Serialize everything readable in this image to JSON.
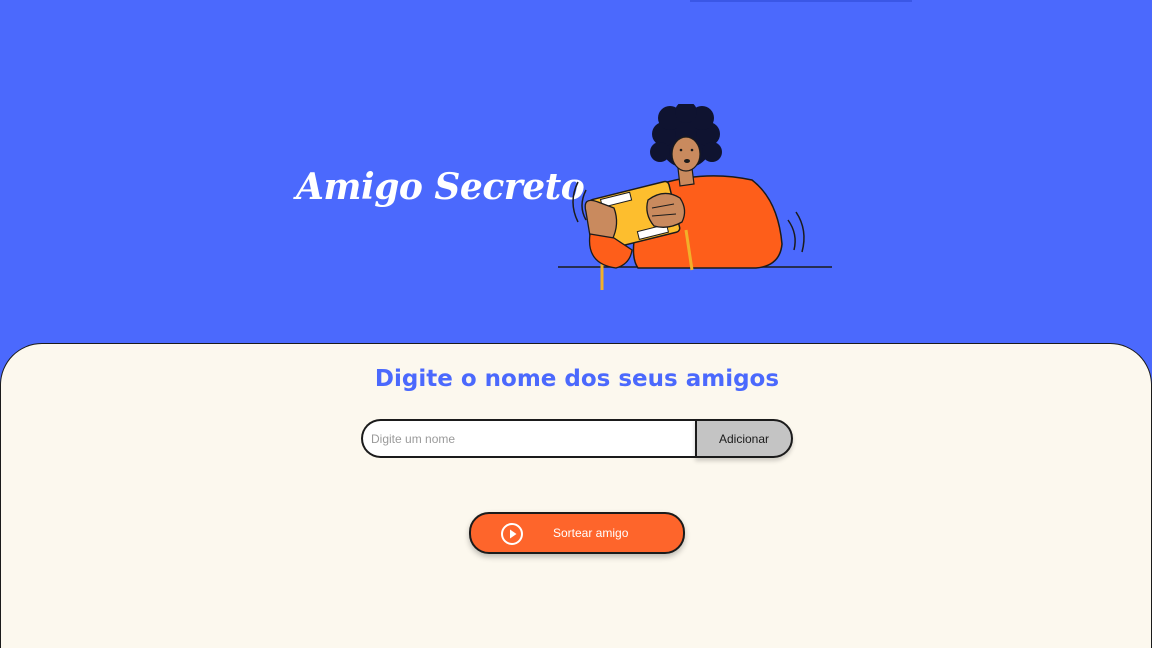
{
  "header": {
    "title": "Amigo Secreto",
    "illustration": "person-playing-handheld-game",
    "background_color": "#4B69FD"
  },
  "main": {
    "subtitle": "Digite o nome dos seus amigos",
    "background_color": "#FCF8EE",
    "name_input": {
      "placeholder": "Digite um nome",
      "value": ""
    },
    "add_button_label": "Adicionar",
    "draw_button": {
      "label": "Sortear amigo",
      "icon": "play-circle-icon",
      "color": "#FE652B"
    }
  }
}
